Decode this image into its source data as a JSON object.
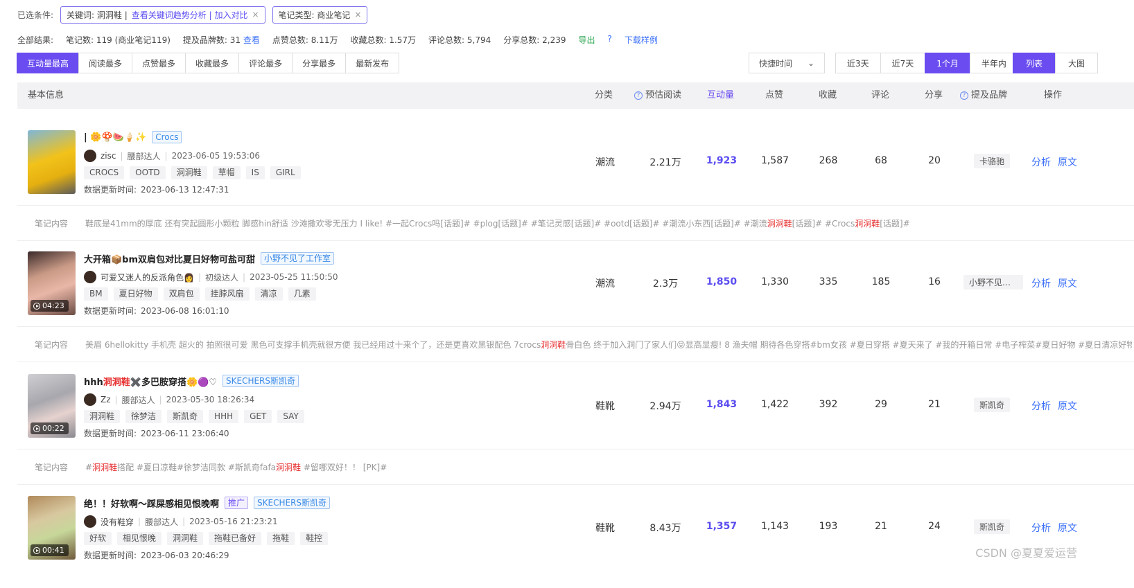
{
  "filters": {
    "label": "已选条件:",
    "chip1": {
      "text": "关键词: 洞洞鞋 |",
      "link": "查看关键词趋势分析 | 加入对比"
    },
    "chip2": {
      "text": "笔记类型: 商业笔记"
    },
    "close_glyph": "×"
  },
  "summary": {
    "total": "全部结果:",
    "notes": "笔记数: 119 (商业笔记119)",
    "brands": "提及品牌数: 31",
    "view": "查看",
    "likes": "点赞总数: 8.11万",
    "collects": "收藏总数: 1.57万",
    "comments": "评论总数: 5,794",
    "shares": "分享总数: 2,239",
    "export": "导出",
    "help": "?",
    "download": "下载样例"
  },
  "sort_tabs": [
    "互动量最高",
    "阅读最多",
    "点赞最多",
    "收藏最多",
    "评论最多",
    "分享最多",
    "最新发布"
  ],
  "quick_time": {
    "label": "快捷时间",
    "arrow": "⌄"
  },
  "ranges": [
    "近3天",
    "近7天",
    "1个月",
    "半年内"
  ],
  "views": [
    "列表",
    "大图"
  ],
  "table_header": {
    "basic": "基本信息",
    "category": "分类",
    "est_read": "预估阅读",
    "interaction": "互动量",
    "likes": "点赞",
    "collects": "收藏",
    "comments": "评论",
    "shares": "分享",
    "brand": "提及品牌",
    "ops": "操作"
  },
  "rows": [
    {
      "title_pre": "| 🌼🍄🍉🍦✨",
      "title_hl": "",
      "title_post": "",
      "tags": [
        {
          "text": "Crocs",
          "type": "blue"
        }
      ],
      "author": "zisc",
      "level": "腰部达人",
      "time": "2023-06-05 19:53:06",
      "keywords": [
        "CROCS",
        "OOTD",
        "洞洞鞋",
        "草帽",
        "IS",
        "GIRL"
      ],
      "update_label": "数据更新时间:",
      "update": "2023-06-13 12:47:31",
      "duration": "",
      "category": "潮流",
      "est_read": "2.21万",
      "interaction": "1,923",
      "likes": "1,587",
      "collects": "268",
      "comments": "68",
      "shares": "20",
      "brand": "卡骆驰",
      "content_label": "笔记内容",
      "content": [
        {
          "t": "鞋底是41mm的厚底 还有突起圆形小颗粒 脚感hin舒适 沙滩撒欢零无压力 I like!  #一起Crocs吗[话题]# #plog[话题]# #笔记灵感[话题]# #ootd[话题]# #潮流小东西[话题]# #潮流",
          "h": false
        },
        {
          "t": "洞洞鞋",
          "h": true
        },
        {
          "t": "[话题]# #Crocs",
          "h": false
        },
        {
          "t": "洞洞鞋",
          "h": true
        },
        {
          "t": "[话题]#",
          "h": false
        }
      ],
      "thumb": "yellow"
    },
    {
      "title_pre": "大开箱📦bm双肩包对比夏日好物可盐可甜",
      "title_hl": "",
      "title_post": "",
      "tags": [
        {
          "text": "小野不见了工作室",
          "type": "blue"
        }
      ],
      "author": "可爱又迷人的反派角色👩",
      "level": "初级达人",
      "time": "2023-05-25 11:50:50",
      "keywords": [
        "BM",
        "夏日好物",
        "双肩包",
        "挂脖风扇",
        "清凉",
        "几素"
      ],
      "update_label": "数据更新时间:",
      "update": "2023-06-08 16:01:10",
      "duration": "04:23",
      "category": "潮流",
      "est_read": "2.3万",
      "interaction": "1,850",
      "likes": "1,330",
      "collects": "335",
      "comments": "185",
      "shares": "16",
      "brand": "小野不见了...",
      "content_label": "笔记内容",
      "content": [
        {
          "t": "美眉 6hellokitty 手机壳 超火的 拍照很可爱 黑色可支撑手机壳就很方便 我已经用过十来个了，还是更喜欢黑银配色 7crocs",
          "h": false
        },
        {
          "t": "洞洞鞋",
          "h": true
        },
        {
          "t": "骨白色 终于加入洞门了家人们😝显高显瘦!  8 渔夫帽 期待各色穿搭#bm女孩 #夏日穿搭 #夏天来了 #我的开箱日常 #电子榨菜#夏日好物 #夏日清凉好物",
          "h": false
        }
      ],
      "thumb": "pink"
    },
    {
      "title_pre": "hhh",
      "title_hl": "洞洞鞋",
      "title_post": "✖️多巴胺穿搭🌼🟣♡",
      "tags": [
        {
          "text": "SKECHERS斯凯奇",
          "type": "blue"
        }
      ],
      "author": "Zz",
      "level": "腰部达人",
      "time": "2023-05-30 18:26:34",
      "keywords": [
        "洞洞鞋",
        "徐梦洁",
        "斯凯奇",
        "HHH",
        "GET",
        "SAY"
      ],
      "update_label": "数据更新时间:",
      "update": "2023-06-11 23:06:40",
      "duration": "00:22",
      "category": "鞋靴",
      "est_read": "2.94万",
      "interaction": "1,843",
      "likes": "1,422",
      "collects": "392",
      "comments": "29",
      "shares": "21",
      "brand": "斯凯奇",
      "content_label": "笔记内容",
      "content": [
        {
          "t": "#",
          "h": false
        },
        {
          "t": "洞洞鞋",
          "h": true
        },
        {
          "t": "搭配 #夏日凉鞋#徐梦洁同款 #斯凯奇fafa",
          "h": false
        },
        {
          "t": "洞洞鞋",
          "h": true
        },
        {
          "t": " #留哪双好！！ [PK]#",
          "h": false
        }
      ],
      "thumb": "gray"
    },
    {
      "title_pre": "绝！！好软啊～踩屎感相见恨晚啊",
      "title_hl": "",
      "title_post": "",
      "tags": [
        {
          "text": "推广",
          "type": "purple"
        },
        {
          "text": "SKECHERS斯凯奇",
          "type": "blue"
        }
      ],
      "author": "没有鞋穿",
      "level": "腰部达人",
      "time": "2023-05-16 21:23:21",
      "keywords": [
        "好软",
        "相见恨晚",
        "洞洞鞋",
        "拖鞋已备好",
        "拖鞋",
        "鞋控"
      ],
      "update_label": "数据更新时间:",
      "update": "2023-06-03 20:46:29",
      "duration": "00:41",
      "category": "鞋靴",
      "est_read": "8.43万",
      "interaction": "1,357",
      "likes": "1,143",
      "collects": "193",
      "comments": "21",
      "shares": "24",
      "brand": "斯凯奇",
      "content_label": "",
      "content": [],
      "thumb": "green"
    }
  ],
  "watermark": "CSDN @夏夏爱运营",
  "colors": {
    "accent": "#6a4cf0",
    "link": "#3a6ff7",
    "highlight": "#e63030"
  }
}
